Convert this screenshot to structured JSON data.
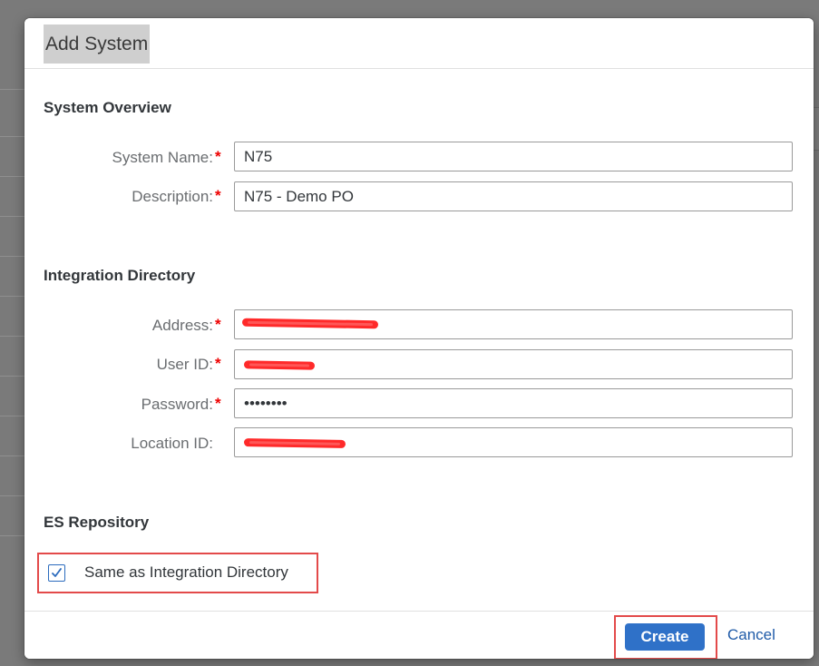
{
  "dialog": {
    "title": "Add System",
    "required_marker": "*"
  },
  "system_overview": {
    "section_title": "System Overview",
    "system_name_label": "System Name:",
    "system_name_value": "N75",
    "description_label": "Description:",
    "description_value": "N75 - Demo PO"
  },
  "integration_directory": {
    "section_title": "Integration Directory",
    "address_label": "Address:",
    "user_id_label": "User ID:",
    "password_label": "Password:",
    "password_value": "••••••••",
    "location_id_label": "Location ID:"
  },
  "es_repository": {
    "section_title": "ES Repository",
    "same_as_label": "Same as Integration Directory",
    "same_as_checked": true
  },
  "footer": {
    "create_label": "Create",
    "cancel_label": "Cancel"
  },
  "colors": {
    "primary_button": "#2f71c8",
    "required": "#e00000",
    "highlight_outline": "#e34a4a",
    "redaction": "#ff2a2a"
  }
}
